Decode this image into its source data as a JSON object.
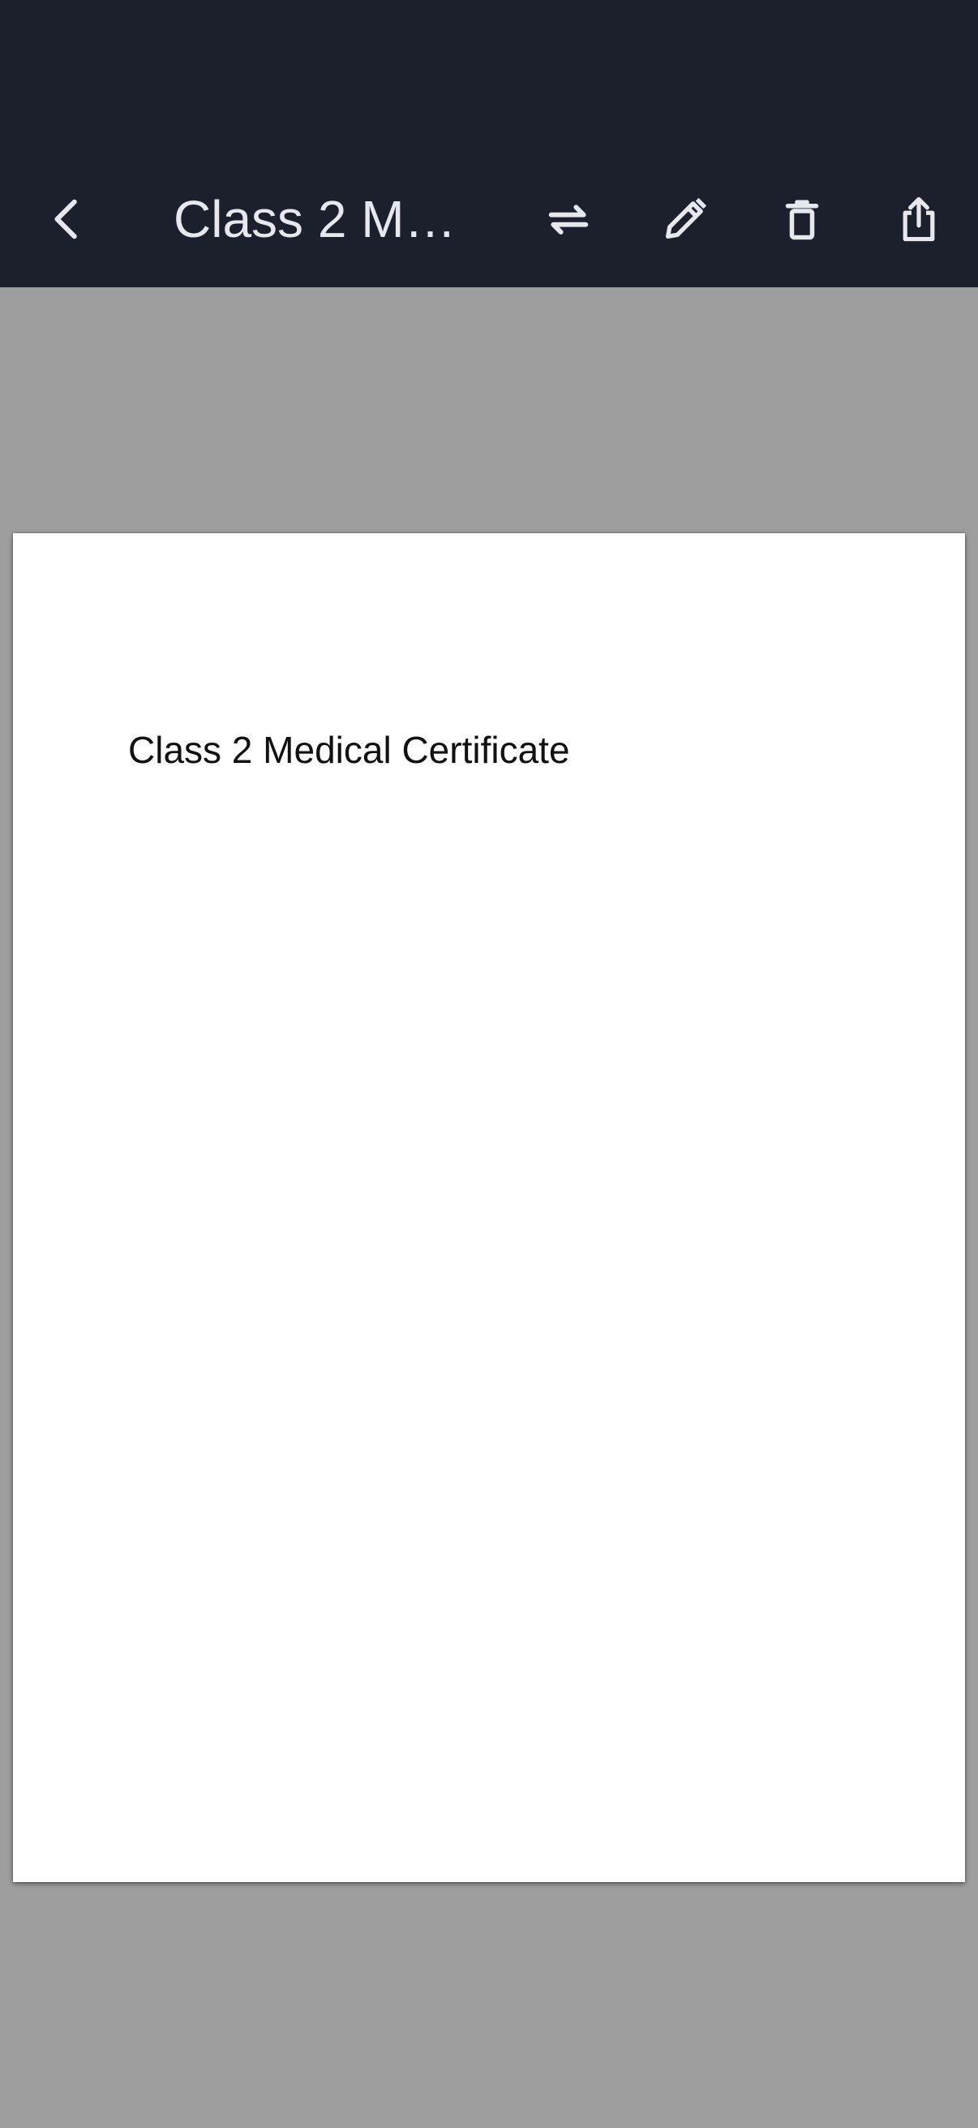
{
  "header": {
    "title": "Class 2 Medical Certificate",
    "title_display": "Class 2 Me...",
    "icons": {
      "back": "chevron-left-icon",
      "swap": "swap-horizontal-icon",
      "edit": "pencil-icon",
      "delete": "trash-icon",
      "share": "share-icon"
    },
    "colors": {
      "bar_background": "#1c202c",
      "icon_color": "#e6e8ee"
    }
  },
  "document": {
    "page_text": "Class 2 Medical Certificate",
    "colors": {
      "viewer_background": "#9e9e9e",
      "page_background": "#ffffff"
    }
  }
}
